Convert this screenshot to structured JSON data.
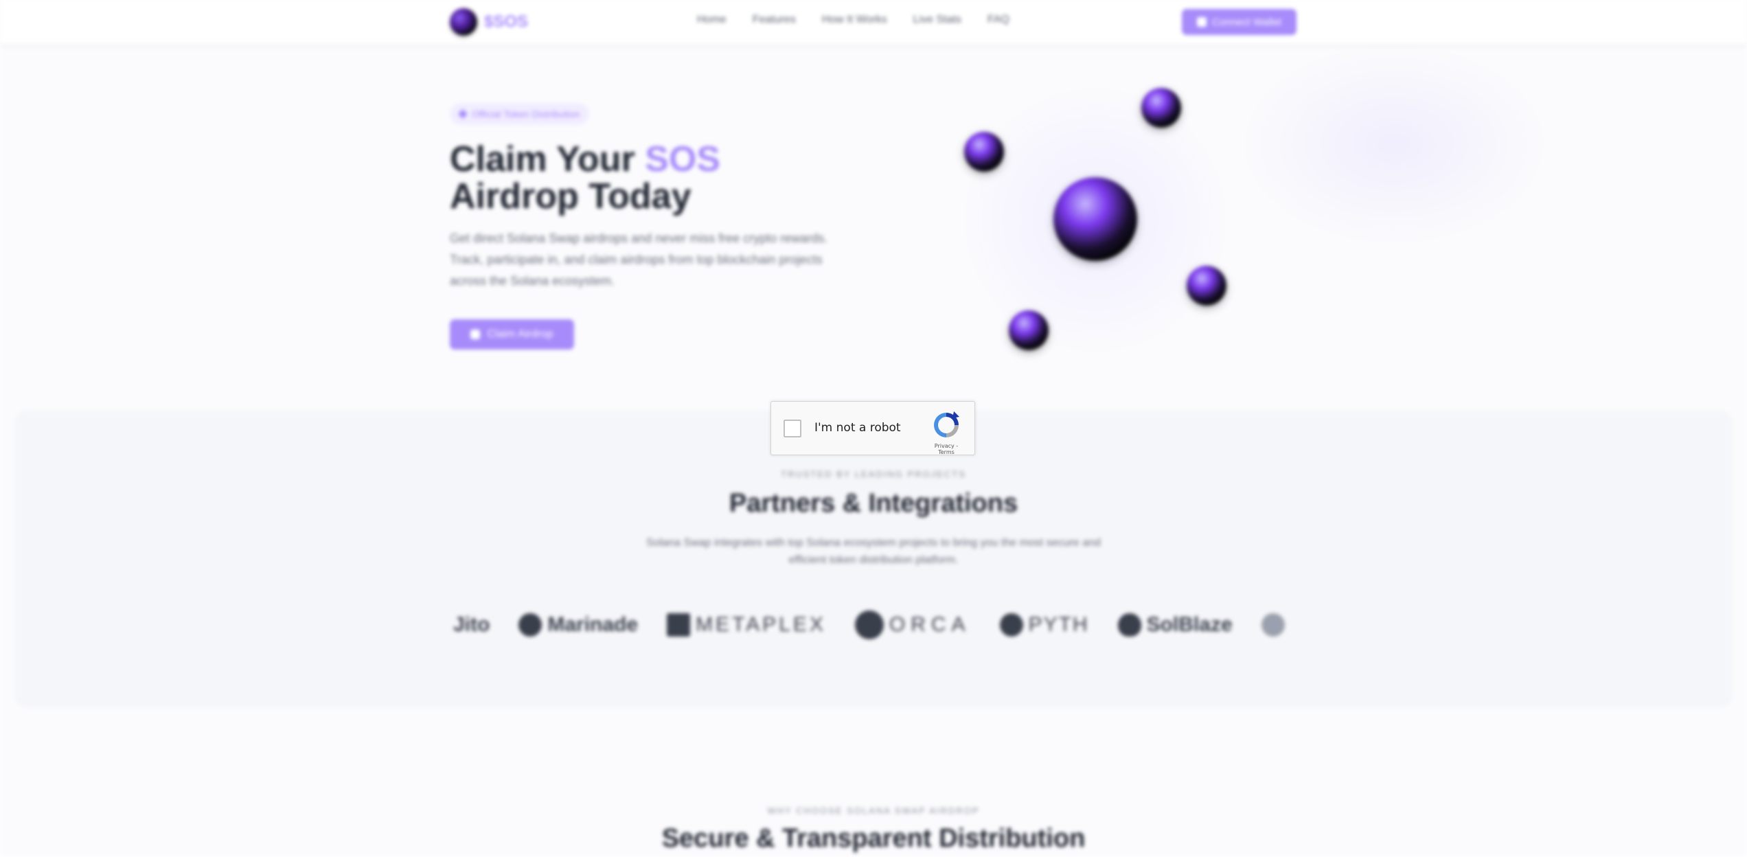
{
  "header": {
    "brand": "$SOS",
    "nav": [
      "Home",
      "Features",
      "How It Works",
      "Live Stats",
      "FAQ"
    ],
    "connect_label": "Connect Wallet"
  },
  "hero": {
    "badge": "Official Token Distribution",
    "title_prefix": "Claim Your ",
    "title_accent": "SOS",
    "title_line2": "Airdrop Today",
    "description": "Get direct Solana Swap airdrops and never miss free crypto rewards. Track, participate in, and claim airdrops from top blockchain projects across the Solana ecosystem.",
    "cta_label": "Claim Airdrop"
  },
  "partners": {
    "kicker": "TRUSTED BY LEADING PROJECTS",
    "title": "Partners & Integrations",
    "subtitle": "Solana Swap integrates with top Solana ecosystem projects to bring you the most secure and efficient token distribution platform.",
    "logos": [
      "Jito",
      "Marinade",
      "METAPLEX",
      "ORCA",
      "PYTH",
      "SolBlaze"
    ]
  },
  "features": {
    "kicker": "WHY CHOOSE SOLANA SWAP AIRDROP",
    "title": "Secure & Transparent Distribution"
  },
  "captcha": {
    "label": "I'm not a robot",
    "links": "Privacy - Terms",
    "checked": false
  }
}
